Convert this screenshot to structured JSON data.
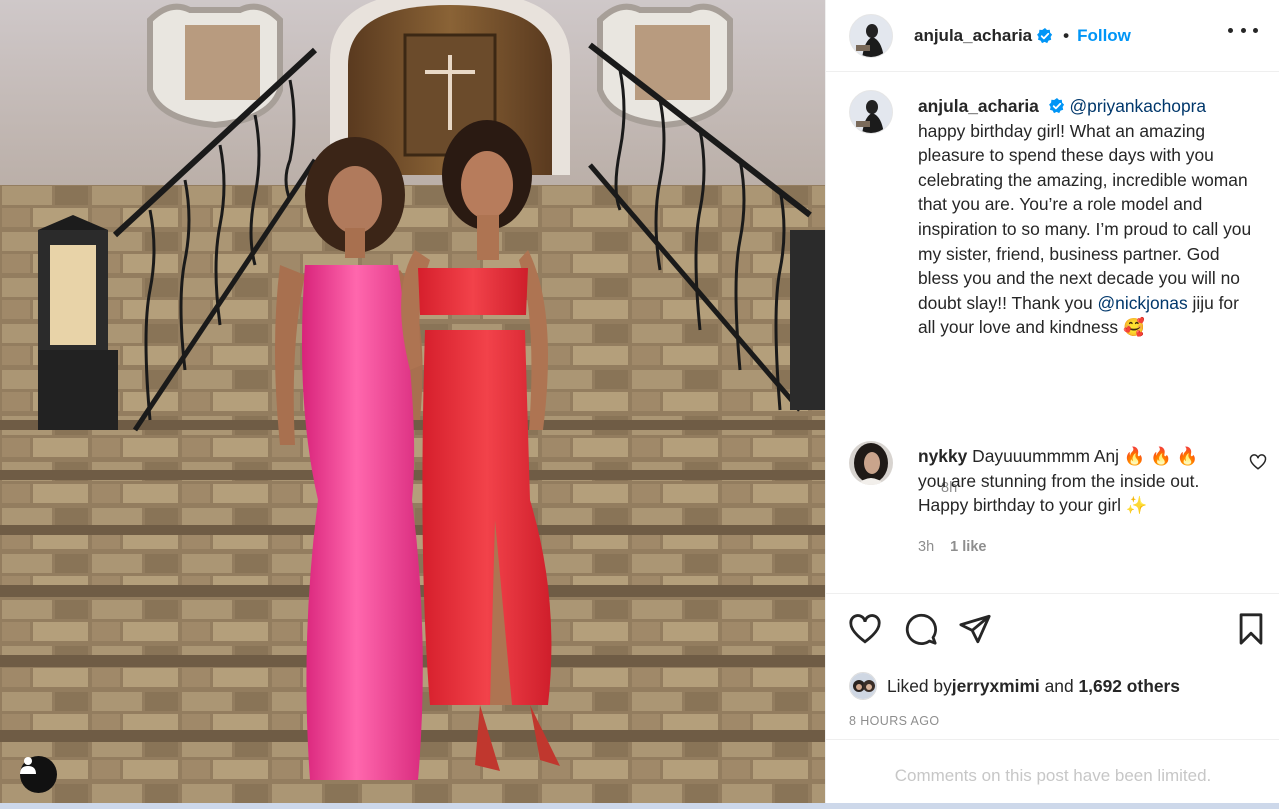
{
  "post": {
    "username": "anjula_acharia",
    "verified": true,
    "follow_label": "Follow",
    "separator": "•",
    "more_icon": "more-horizontal-icon"
  },
  "caption": {
    "username": "anjula_acharia",
    "mention_1": "@priyankachopra",
    "text_1": "happy birthday girl! What an amazing pleasure to spend these days with you celebrating the amazing, incredible woman that you are. You’re a role model and inspiration to so many. I’m proud to call you my sister, friend, business partner. God bless you and the next decade you will no doubt slay!! Thank you ",
    "mention_2": "@nickjonas",
    "text_2": " jiju for all your love and kindness ",
    "emoji": "🥰",
    "time": "8h"
  },
  "comment": {
    "username": "nykky",
    "text": " Dayuuummmm Anj 🔥 🔥 🔥 you are stunning from the inside out. Happy birthday to your girl ✨",
    "time": "3h",
    "likes": "1 like"
  },
  "likes": {
    "prefix": "Liked by ",
    "user": "jerryxmimi",
    "middle": " and ",
    "count": "1,692 others"
  },
  "post_time": "8 HOURS AGO",
  "comments_limited": "Comments on this post have been limited.",
  "colors": {
    "link_blue": "#0095f6",
    "mention_blue": "#00376b",
    "secondary_text": "#8e8e8e",
    "pink_dress": "#f0418f",
    "red_dress": "#ea2d37"
  }
}
